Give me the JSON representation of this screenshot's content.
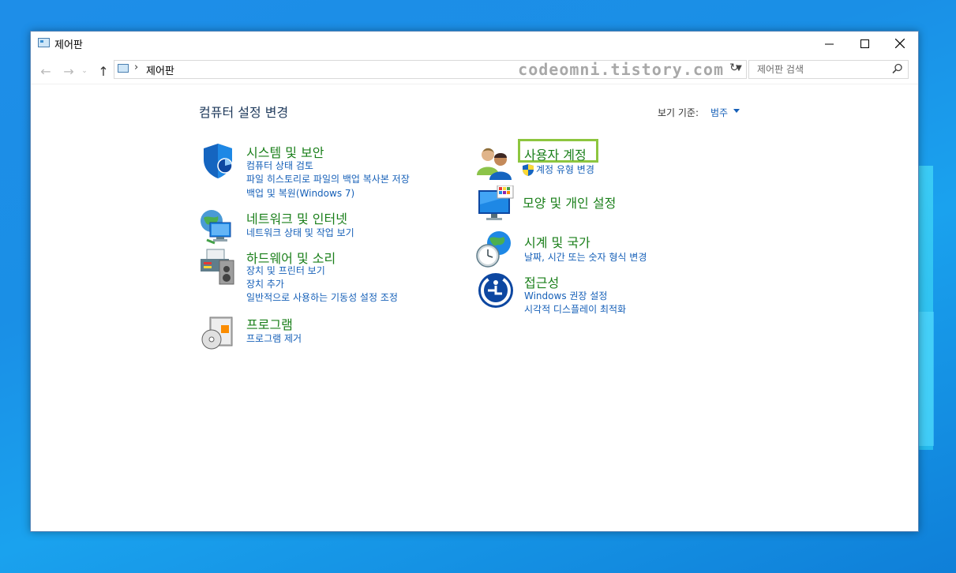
{
  "window": {
    "title": "제어판"
  },
  "address": {
    "path_label": "제어판",
    "separator": "›",
    "watermark": "codeomni.tistory.com",
    "search_placeholder": "제어판 검색"
  },
  "content": {
    "heading": "컴퓨터 설정 변경",
    "view_by_label": "보기 기준:",
    "view_by_value": "범주"
  },
  "categories": {
    "system": {
      "title": "시스템 및 보안",
      "links": [
        "컴퓨터 상태 검토",
        "파일 히스토리로 파일의 백업 복사본 저장",
        "백업 및 복원(Windows 7)"
      ]
    },
    "network": {
      "title": "네트워크 및 인터넷",
      "links": [
        "네트워크 상태 및 작업 보기"
      ]
    },
    "hardware": {
      "title": "하드웨어 및 소리",
      "links": [
        "장치 및 프린터 보기",
        "장치 추가",
        "일반적으로 사용하는 기동성 설정 조정"
      ]
    },
    "programs": {
      "title": "프로그램",
      "links": [
        "프로그램 제거"
      ]
    },
    "users": {
      "title": "사용자 계정",
      "links": [
        "계정 유형 변경"
      ]
    },
    "appearance": {
      "title": "모양 및 개인 설정",
      "links": []
    },
    "clock": {
      "title": "시계 및 국가",
      "links": [
        "날짜, 시간 또는 숫자 형식 변경"
      ]
    },
    "access": {
      "title": "접근성",
      "links": [
        "Windows 권장 설정",
        "시각적 디스플레이 최적화"
      ]
    }
  },
  "icons": {
    "back": "back-arrow-icon",
    "forward": "forward-arrow-icon",
    "up": "up-arrow-icon",
    "refresh": "refresh-icon",
    "search": "search-icon"
  },
  "colors": {
    "category_title": "#1a7f1a",
    "link": "#1660b8",
    "highlight": "#8dc63f"
  }
}
